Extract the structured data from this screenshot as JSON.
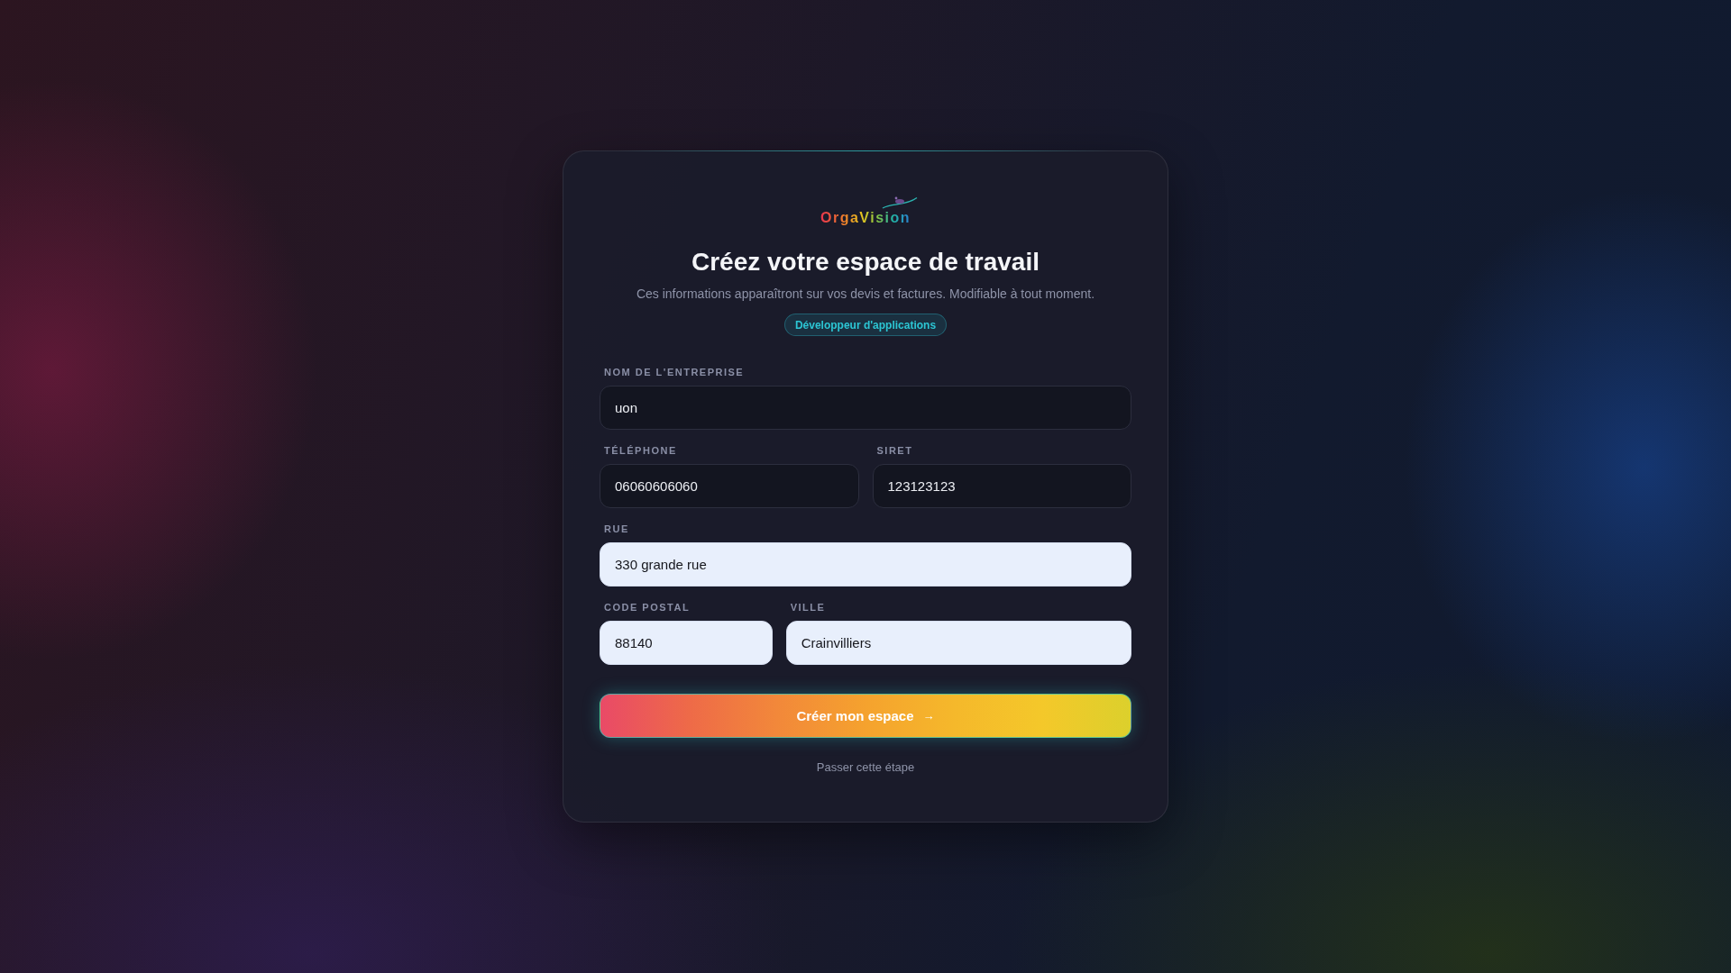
{
  "logo": {
    "text": "OrgaVision"
  },
  "title": "Créez votre espace de travail",
  "subtitle": "Ces informations apparaîtront sur vos devis et factures. Modifiable à tout moment.",
  "badge": "Développeur d'applications",
  "form": {
    "rows": [
      {
        "fields": [
          {
            "label": "NOM DE L'ENTREPRISE",
            "value": "uon",
            "kind": "text",
            "autofilled": false
          }
        ]
      },
      {
        "fields": [
          {
            "label": "TÉLÉPHONE",
            "value": "06060606060",
            "kind": "phone",
            "autofilled": false
          },
          {
            "label": "SIRET",
            "value": "123123123",
            "kind": "number",
            "autofilled": false
          }
        ]
      },
      {
        "fields": [
          {
            "label": "RUE",
            "value": "330 grande rue",
            "kind": "text",
            "autofilled": true
          }
        ]
      },
      {
        "fields": [
          {
            "label": "CODE POSTAL",
            "value": "88140",
            "kind": "postal",
            "autofilled": true
          },
          {
            "label": "VILLE",
            "value": "Crainvilliers",
            "kind": "text",
            "autofilled": true
          }
        ]
      }
    ]
  },
  "submit_button": {
    "label": "Créer mon espace",
    "icon": "→"
  },
  "skip_link": "Passer cette étape"
}
